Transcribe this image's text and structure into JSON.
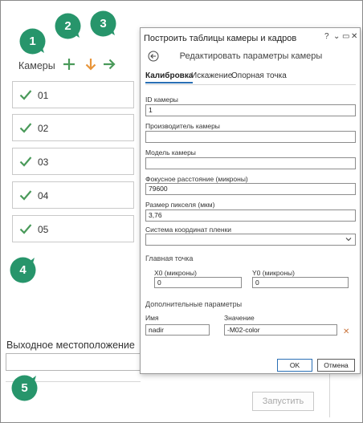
{
  "colors": {
    "accent_green": "#4a9a5a",
    "accent_orange": "#e8953a",
    "callout_green": "#27956b",
    "tab_underline": "#2a6fb5"
  },
  "left_pane": {
    "cameras_label": "Камеры",
    "toolbar": {
      "add_icon": "plus-icon",
      "import_icon": "arrow-down-icon",
      "export_icon": "arrow-right-icon"
    },
    "cameras": [
      {
        "label": "01",
        "status_icon": "checkmark-icon"
      },
      {
        "label": "02",
        "status_icon": "checkmark-icon"
      },
      {
        "label": "03",
        "status_icon": "checkmark-icon"
      },
      {
        "label": "04",
        "status_icon": "checkmark-icon"
      },
      {
        "label": "05",
        "status_icon": "checkmark-icon"
      }
    ],
    "output_location_label": "Выходное местоположение",
    "output_location_value": "",
    "run_button": "Запустить"
  },
  "callouts": [
    "1",
    "2",
    "3",
    "4",
    "5"
  ],
  "dialog": {
    "title": "Построить таблицы камеры и кадров",
    "controls": {
      "help": "?",
      "menu": "⌄",
      "restore": "▭",
      "close": "✕"
    },
    "subtitle": "Редактировать параметры камеры",
    "tabs": [
      "Калибровка",
      "Искажение",
      "Опорная точка"
    ],
    "active_tab": "Калибровка",
    "fields": {
      "camera_id": {
        "label": "ID камеры",
        "value": "1"
      },
      "manufacturer": {
        "label": "Производитель камеры",
        "value": ""
      },
      "model": {
        "label": "Модель камеры",
        "value": ""
      },
      "focal_length": {
        "label": "Фокусное расстояние (микроны)",
        "value": "79600"
      },
      "pixel_size": {
        "label": "Размер пикселя (мкм)",
        "value": "3,76"
      },
      "film_coord_system": {
        "label": "Система координат пленки",
        "value": ""
      }
    },
    "principal_point": {
      "heading": "Главная точка",
      "x0": {
        "label": "X0 (микроны)",
        "value": "0"
      },
      "y0": {
        "label": "Y0 (микроны)",
        "value": "0"
      }
    },
    "additional_params": {
      "heading": "Дополнительные параметры",
      "name_header": "Имя",
      "value_header": "Значение",
      "rows": [
        {
          "name": "nadir",
          "value": "-M02-color"
        }
      ]
    },
    "ok_button": "OK",
    "cancel_button": "Отмена"
  }
}
